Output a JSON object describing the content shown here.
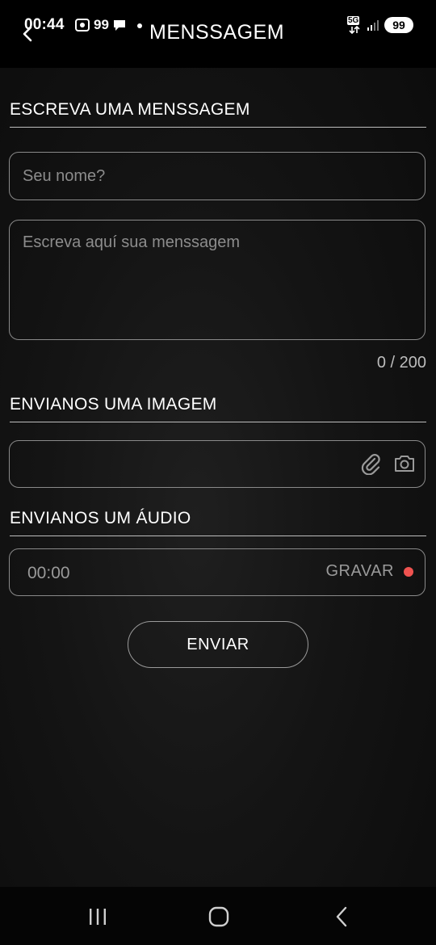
{
  "status_bar": {
    "time": "00:44",
    "notification_count": "99",
    "network": "5G",
    "battery": "99"
  },
  "header": {
    "title": "MENSSAGEM"
  },
  "message_section": {
    "title": "ESCREVA UMA MENSSAGEM",
    "name_placeholder": "Seu nome?",
    "message_placeholder": "Escreva aquí sua menssagem",
    "char_counter": "0 / 200"
  },
  "image_section": {
    "title": "ENVIANOS UMA IMAGEM"
  },
  "audio_section": {
    "title": "ENVIANOS UM ÁUDIO",
    "timer": "00:00",
    "record_label": "GRAVAR"
  },
  "actions": {
    "send_label": "ENVIAR"
  },
  "colors": {
    "record_dot": "#ef5350",
    "background": "#0b0b0b",
    "border": "#8a8a8a"
  }
}
